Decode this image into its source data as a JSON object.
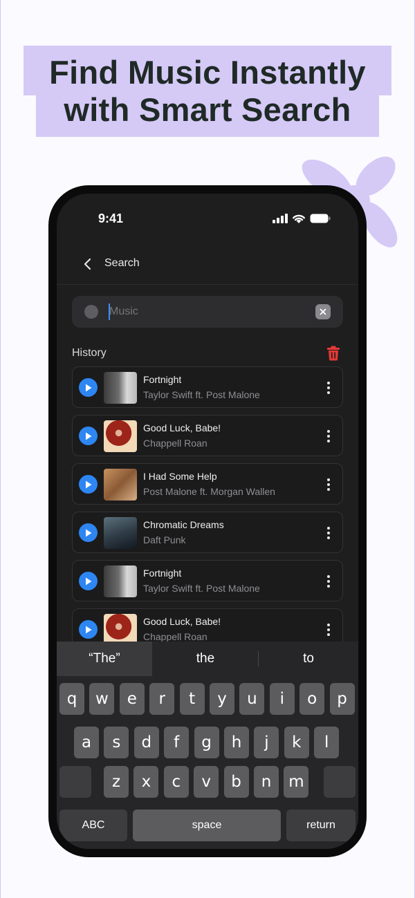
{
  "headline": {
    "line1": "Find Music Instantly",
    "line2": "with Smart Search"
  },
  "status_bar": {
    "time": "9:41"
  },
  "nav": {
    "title": "Search"
  },
  "search": {
    "value": "",
    "placeholder": "Music"
  },
  "history": {
    "label": "History",
    "items": [
      {
        "title": "Fortnight",
        "artist": "Taylor Swift ft. Post Malone",
        "cover": "taylor-swift-cover"
      },
      {
        "title": "Good Luck, Babe!",
        "artist": "Chappell Roan",
        "cover": "chappell-roan-cover"
      },
      {
        "title": "I Had Some Help",
        "artist": "Post Malone ft. Morgan Wallen",
        "cover": "post-malone-cover"
      },
      {
        "title": "Chromatic Dreams",
        "artist": "Daft Punk",
        "cover": "daft-punk-cover"
      },
      {
        "title": "Fortnight",
        "artist": "Taylor Swift ft. Post Malone",
        "cover": "taylor-swift-cover"
      },
      {
        "title": "Good Luck, Babe!",
        "artist": "Chappell Roan",
        "cover": "chappell-roan-cover"
      }
    ]
  },
  "keyboard": {
    "suggestions": [
      "“The”",
      "the",
      "to"
    ],
    "row1": [
      "q",
      "w",
      "e",
      "r",
      "t",
      "y",
      "u",
      "i",
      "o",
      "p"
    ],
    "row2": [
      "a",
      "s",
      "d",
      "f",
      "g",
      "h",
      "j",
      "k",
      "l"
    ],
    "row3": [
      "z",
      "x",
      "c",
      "v",
      "b",
      "n",
      "m"
    ],
    "abc_label": "ABC",
    "space_label": "space",
    "return_label": "return"
  },
  "colors": {
    "accent": "#2e86f2",
    "headline_highlight": "#d5c9f6",
    "delete": "#e53935",
    "screen_bg": "#1e1e1f"
  }
}
